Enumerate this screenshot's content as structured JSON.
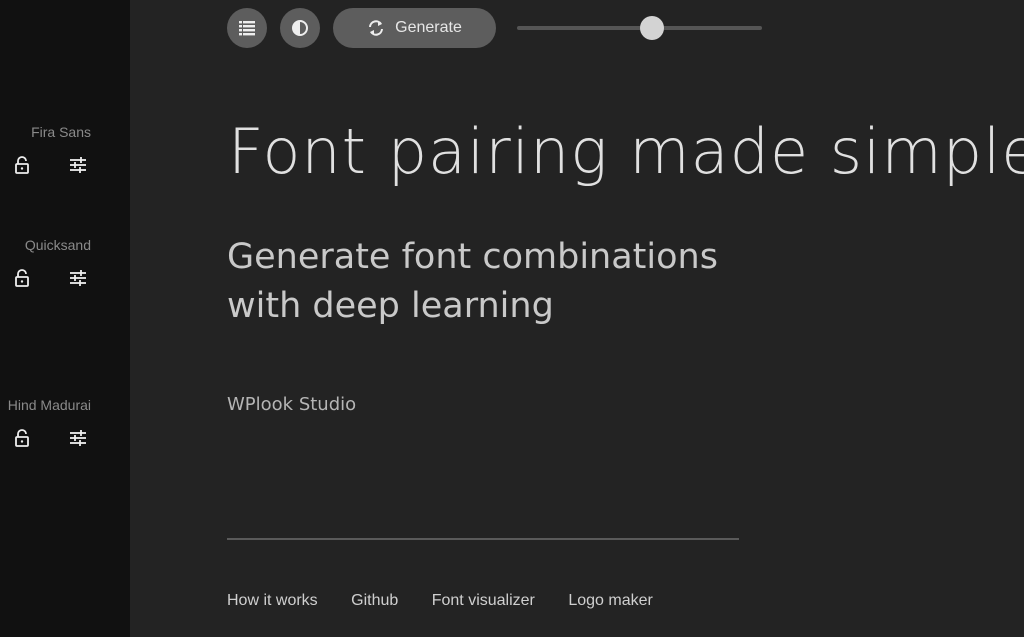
{
  "sidebar": {
    "fonts": [
      {
        "name": "Fira Sans",
        "lock_icon": "lock-open-icon",
        "adjust_icon": "tune-icon"
      },
      {
        "name": "Quicksand",
        "lock_icon": "lock-open-icon",
        "adjust_icon": "tune-icon"
      },
      {
        "name": "Hind Madurai",
        "lock_icon": "lock-open-icon",
        "adjust_icon": "tune-icon"
      }
    ]
  },
  "toolbar": {
    "list_icon": "list-icon",
    "contrast_icon": "contrast-icon",
    "generate_icon": "refresh-icon",
    "generate_label": "Generate",
    "slider_value": 0.55
  },
  "hero": {
    "title": "Font pairing made simple",
    "subtitle_line1": "Generate font combinations",
    "subtitle_line2": "with deep learning",
    "author": "WPlook Studio"
  },
  "footer": {
    "links": [
      "How it works",
      "Github",
      "Font visualizer",
      "Logo maker"
    ]
  },
  "colors": {
    "background": "#232323",
    "sidebar": "#111111",
    "button": "#5d5d5d",
    "slider_thumb": "#d3d3d3"
  }
}
